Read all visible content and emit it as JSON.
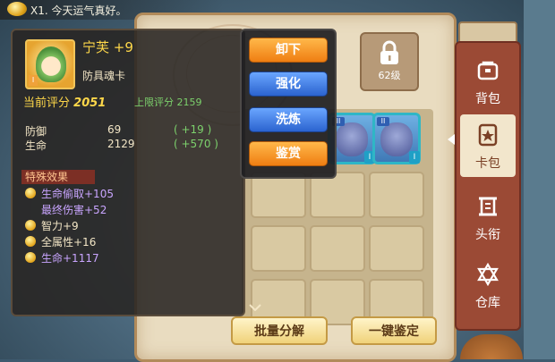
{
  "top_notice": {
    "text": "X1. 今天运气真好。"
  },
  "lock_slot": {
    "level_label": "62级"
  },
  "item": {
    "name": "宁芙",
    "enhance": "+9",
    "type": "防具魂卡",
    "rank_badge": "I",
    "current_score_label": "当前评分",
    "current_score": "2051",
    "max_score_label": "上限评分",
    "max_score": "2159",
    "stats": [
      {
        "label": "防御",
        "value": "69",
        "bonus": "( +19 )"
      },
      {
        "label": "生命",
        "value": "2129",
        "bonus": "( +570 )"
      }
    ],
    "effects_title": "特殊效果",
    "effects": [
      {
        "text": "生命偷取+105",
        "style": "purple"
      },
      {
        "text": "最终伤害+52",
        "style": "purple"
      },
      {
        "text": "智力+9",
        "style": "white"
      },
      {
        "text": "全属性+16",
        "style": "white"
      },
      {
        "text": "生命+1117",
        "style": "purple"
      }
    ]
  },
  "action_menu": [
    {
      "label": "卸下",
      "style": "orange"
    },
    {
      "label": "强化",
      "style": "blue"
    },
    {
      "label": "洗炼",
      "style": "blue"
    },
    {
      "label": "鉴赏",
      "style": "orange"
    }
  ],
  "bottom_buttons": {
    "batch_decompose": "批量分解",
    "one_key_appraise": "一键鉴定"
  },
  "sidebar": {
    "tabs": [
      {
        "label": "背包",
        "icon": "bag-icon",
        "active": false
      },
      {
        "label": "卡包",
        "icon": "card-pack-icon",
        "active": true
      },
      {
        "label": "头衔",
        "icon": "scroll-icon",
        "active": false
      },
      {
        "label": "仓库",
        "icon": "star-of-david-icon",
        "active": false
      }
    ]
  },
  "card_badges": {
    "tag": "II",
    "corner": "I"
  },
  "colors": {
    "accent_orange": "#ef7e12",
    "accent_blue": "#2b63cf",
    "panel": "#e9dcc0",
    "sidebar": "#9b4a35"
  }
}
